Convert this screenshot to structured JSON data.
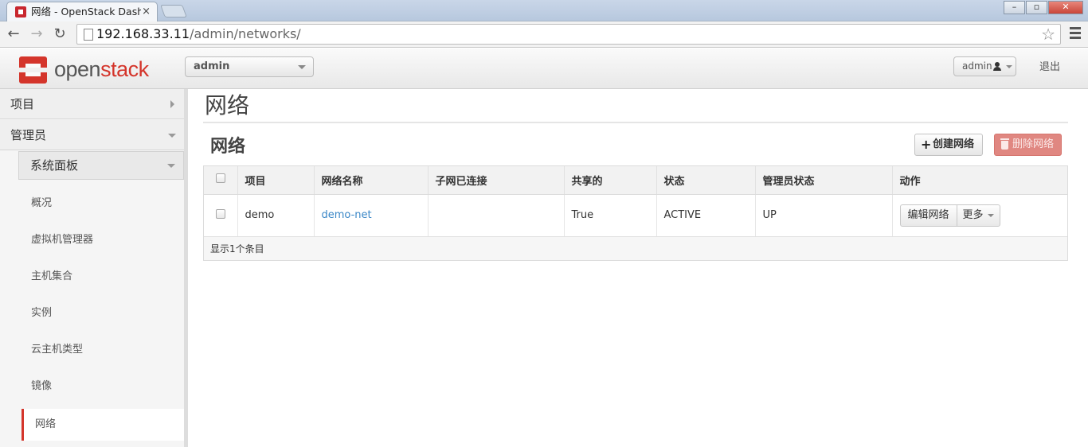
{
  "browser": {
    "tab_title": "网络 - OpenStack Dashb",
    "tab_close": "×",
    "url_host": "192.168.33.11",
    "url_path": "/admin/networks/"
  },
  "header": {
    "logo_open": "open",
    "logo_stack": "stack",
    "project": "admin",
    "user": "admin",
    "logout": "退出"
  },
  "sidebar": {
    "project": "项目",
    "admin": "管理员",
    "panel": "系统面板",
    "items": [
      "概况",
      "虚拟机管理器",
      "主机集合",
      "实例",
      "云主机类型",
      "镜像",
      "网络"
    ]
  },
  "main": {
    "page_title": "网络",
    "section_title": "网络",
    "create_label": "创建网络",
    "delete_label": "删除网络",
    "columns": [
      "项目",
      "网络名称",
      "子网已连接",
      "共享的",
      "状态",
      "管理员状态",
      "动作"
    ],
    "rows": [
      {
        "project": "demo",
        "name": "demo-net",
        "subnets": "",
        "shared": "True",
        "status": "ACTIVE",
        "admin_state": "UP",
        "edit_label": "编辑网络",
        "more_label": "更多"
      }
    ],
    "footer": "显示1个条目"
  },
  "colors": {
    "brand": "#d4352b",
    "link": "#3a87c7",
    "danger": "#e08781"
  }
}
